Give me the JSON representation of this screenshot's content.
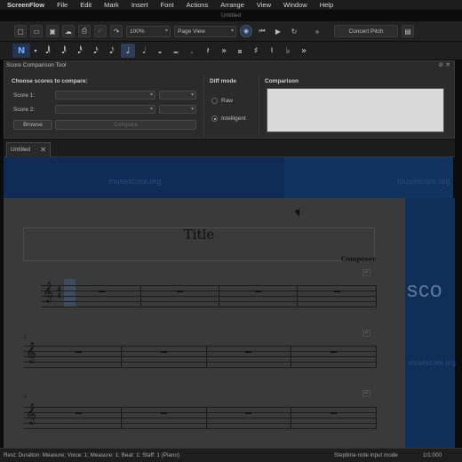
{
  "menubar": {
    "items": [
      "ScreenFlow",
      "File",
      "Edit",
      "Mark",
      "Insert",
      "Font",
      "Actions",
      "Arrange",
      "View",
      "Window",
      "Help"
    ]
  },
  "window": {
    "title": "Untitled"
  },
  "toolbar": {
    "zoom_value": "100%",
    "view_mode": "Page View",
    "concert_pitch_label": "Concert Pitch",
    "icons": [
      "new-file-icon",
      "open-folder-icon",
      "save-icon",
      "cloud-upload-icon",
      "print-icon",
      "undo-icon",
      "redo-icon",
      "zoom-select",
      "view-mode-select",
      "metronome-icon",
      "rewind-icon",
      "play-icon",
      "loop-icon",
      "more-icon",
      "concert-pitch-toggle",
      "image-capture-icon"
    ]
  },
  "note_toolbar": {
    "mode_label": "N",
    "glyphs": [
      "𝅘𝅥𝅲",
      "𝅘𝅥𝅱",
      "𝅘𝅥𝅰",
      "𝅘𝅥𝅯",
      "𝅘𝅥𝅮",
      "♩",
      "𝅗𝅥",
      "𝅝",
      "𝅜",
      ".",
      "𝄽",
      "»",
      "𝄪",
      "♯",
      "♮",
      "♭",
      "»"
    ],
    "selected_index": 5
  },
  "compare_panel": {
    "title": "Score Comparison Tool",
    "choose_label": "Choose scores to compare:",
    "score1_label": "Score 1:",
    "score2_label": "Score 2:",
    "browse_label": "Browse",
    "compare_label": "Compare",
    "diff_mode_label": "Diff mode",
    "raw_label": "Raw",
    "intelligent_label": "Intelligent",
    "comparison_label": "Comparison"
  },
  "tabs": [
    {
      "label": "Untitled"
    }
  ],
  "score": {
    "watermark": "musescore.org",
    "watermark_right": "musescore.org",
    "big_text": "sco",
    "title": "Title",
    "composer": "Composer",
    "time_sig_top": "4",
    "time_sig_bottom": "4",
    "system2_measure": "5",
    "system3_measure": "9"
  },
  "statusbar": {
    "left": "Rest; Duration: Measure; Voice: 1;  Measure: 1; Beat: 1; Staff: 1 (Piano)",
    "mode": "Steptime note input mode",
    "time": "1/1:000"
  },
  "colors": {
    "accent": "#3d7bd9",
    "banner": "#0e2c55"
  }
}
